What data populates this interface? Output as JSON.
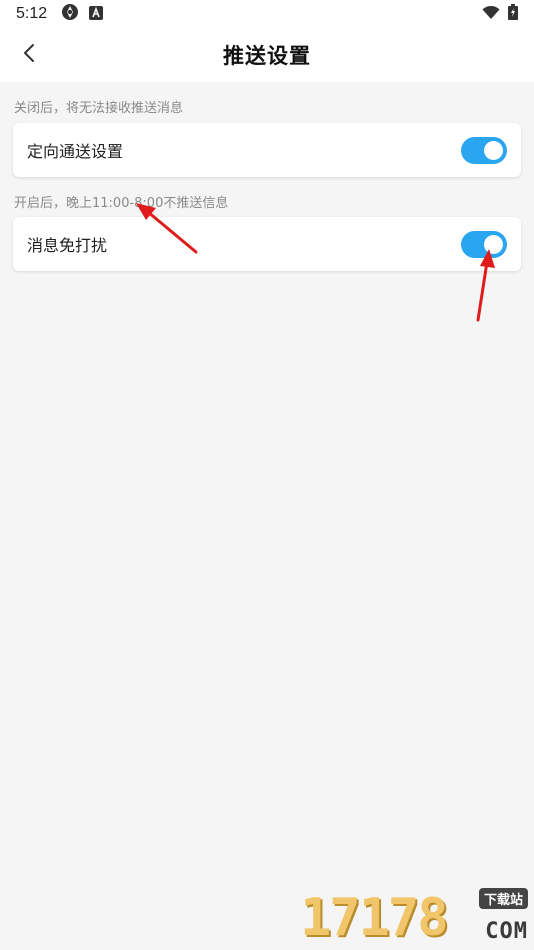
{
  "status_bar": {
    "time": "5:12",
    "left_icons": [
      "aperture-icon",
      "a-badge-icon"
    ],
    "right_icons": [
      "wifi-icon",
      "battery-charging-icon"
    ]
  },
  "header": {
    "title": "推送设置",
    "back_icon": "chevron-left-icon"
  },
  "settings": [
    {
      "hint": "关闭后，将无法接收推送消息",
      "label": "定向通送设置",
      "enabled": true
    },
    {
      "hint": "开启后，晚上11:00-8:00不推送信息",
      "label": "消息免打扰",
      "enabled": true
    }
  ],
  "watermark": {
    "digits": "17178",
    "badge": "下载站",
    "suffix": "COM"
  },
  "colors": {
    "toggle_on": "#2aa5f0",
    "annotation_arrow": "#e01b1b",
    "background": "#f5f5f5"
  }
}
